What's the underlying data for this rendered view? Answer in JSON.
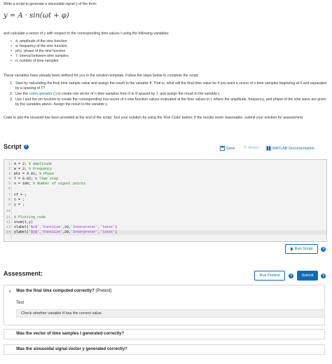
{
  "intro": "Write a script to generate a sinusoidal signal y of the form:",
  "formula": "y = A · sin(ωt + φ)",
  "calc_text": "and calculate a vector of y with respect to the corresponding time values t using the following variables:",
  "variables": [
    {
      "name": "A",
      "desc": ": amplitude of the sine function"
    },
    {
      "name": "w",
      "desc": ": frequency of the sine function"
    },
    {
      "name": "phi",
      "desc": ": phase of the sine function"
    },
    {
      "name": "T",
      "desc": ": interval between time samples"
    },
    {
      "name": "n",
      "desc": ": number of time samples"
    }
  ],
  "defined_text": "These variables have already been defined for you in the solution template. Follow the steps below to complete the script:",
  "steps": [
    {
      "num": "1.",
      "text": "Start by calculating the final time sample value and assign the result to the variable tf. That is, what will the final time value be if you want a vector of n time samples beginning at 0 and separated by a spacing of T?"
    },
    {
      "num": "2.",
      "pre": "Use the ",
      "link": "colon operator",
      "post": " (:) to create row vector of n time samples from 0 to tf spaced by T, and assign the result to the variable t."
    },
    {
      "num": "3.",
      "text": "Use t and the sin function to create the corresponding row vector of n sine function values evaluated at the time values in t, where the amplitude, frequency, and phase of the sine wave are given by the variables above. Assign the result to the variable y."
    }
  ],
  "code_note": "Code to plot the sinusoid has been provided at the end of the script. Test your solution by using the 'Run Code' button; if the results seem reasonable, submit your solution for assessment.",
  "script": {
    "title": "Script",
    "save": "Save",
    "reset": "Reset",
    "docs": "MATLAB Documentation",
    "lines": [
      {
        "n": "1",
        "code": "A = 2; ",
        "comment": "% Amplitude"
      },
      {
        "n": "2",
        "code": "w = 3; ",
        "comment": "% Frequency"
      },
      {
        "n": "3",
        "code": "phi = 0.01; ",
        "comment": "% Phase"
      },
      {
        "n": "4",
        "code": "T = 0.02; ",
        "comment": "% Time step"
      },
      {
        "n": "5",
        "code": "n = 100; ",
        "comment": "% Number of signal points"
      },
      {
        "n": "6",
        "code": ""
      },
      {
        "n": "7",
        "code": "tf = ;"
      },
      {
        "n": "8",
        "code": "t = ;"
      },
      {
        "n": "9",
        "code": "y = ;"
      },
      {
        "n": "10",
        "code": ""
      },
      {
        "n": "11",
        "code": "",
        "comment": "% Plotting code"
      },
      {
        "n": "12",
        "code": "stem(t,y)"
      },
      {
        "n": "13",
        "code": "xlabel(",
        "str": "'$t$','FontSize'",
        "code2": ",20,",
        "str2": "'Interpreter','latex'",
        "code3": ")"
      },
      {
        "n": "14",
        "code": "ylabel(",
        "str": "'$y$','FontSize'",
        "code2": ",20,",
        "str2": "'Interpreter','latex'",
        "code3": ")"
      }
    ],
    "run_label": "Run Script"
  },
  "assessment": {
    "title": "Assessment:",
    "run_pretest": "Run Pretest",
    "submit": "Submit",
    "tests": [
      {
        "title": "Was the final time computed correctly?",
        "tag": "(Pretest)",
        "label": "Test",
        "body": "Check whether variable tf has the correct value."
      },
      {
        "title": "Was the vector of time samples t generated correctly?"
      },
      {
        "title": "Was the sinusoidal signal vector y generated correctly?"
      }
    ]
  },
  "colors": {
    "accent": "#0b6bbd",
    "comment": "#228b22",
    "string": "#a020f0"
  }
}
